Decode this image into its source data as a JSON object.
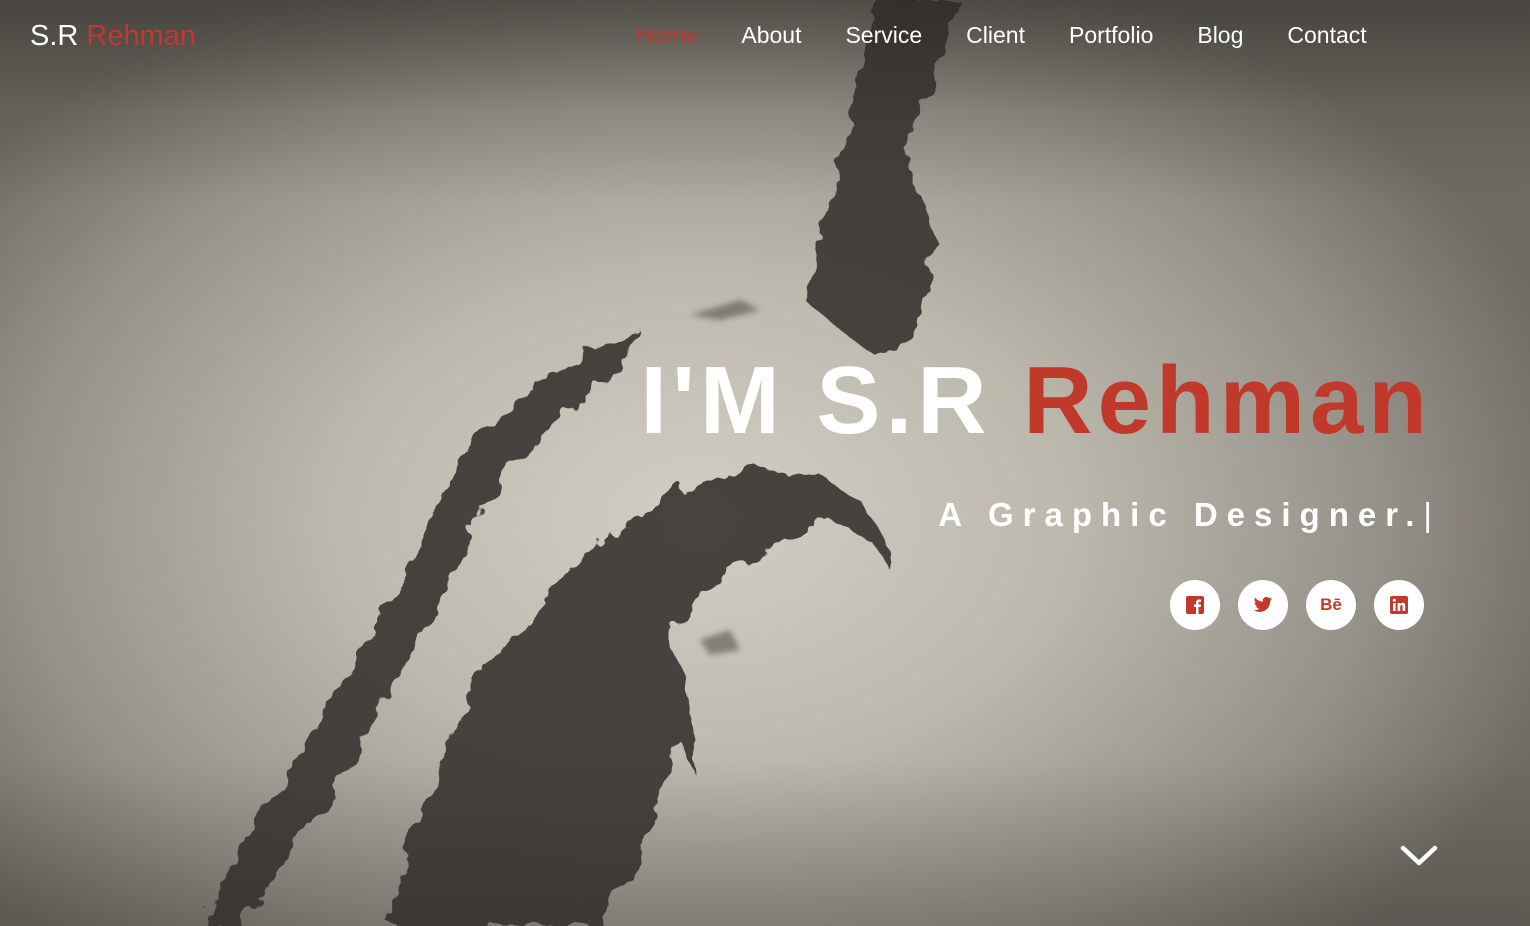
{
  "brand": {
    "first": "S.R ",
    "accent": "Rehman"
  },
  "nav": {
    "items": [
      {
        "label": "Home",
        "active": true
      },
      {
        "label": "About"
      },
      {
        "label": "Service"
      },
      {
        "label": "Client"
      },
      {
        "label": "Portfolio"
      },
      {
        "label": "Blog"
      },
      {
        "label": "Contact"
      }
    ]
  },
  "hero": {
    "headline_prefix": "I'M S.R ",
    "headline_accent": "Rehman",
    "subtitle": "A Graphic Designer.",
    "cursor": "|"
  },
  "socials": [
    {
      "icon": "facebook-icon"
    },
    {
      "icon": "twitter-icon"
    },
    {
      "icon": "behance-icon",
      "label": "Bē"
    },
    {
      "icon": "linkedin-icon"
    }
  ],
  "colors": {
    "accent": "#c0392b",
    "text": "#ffffff"
  },
  "scroll_icon": "chevron-down-icon"
}
